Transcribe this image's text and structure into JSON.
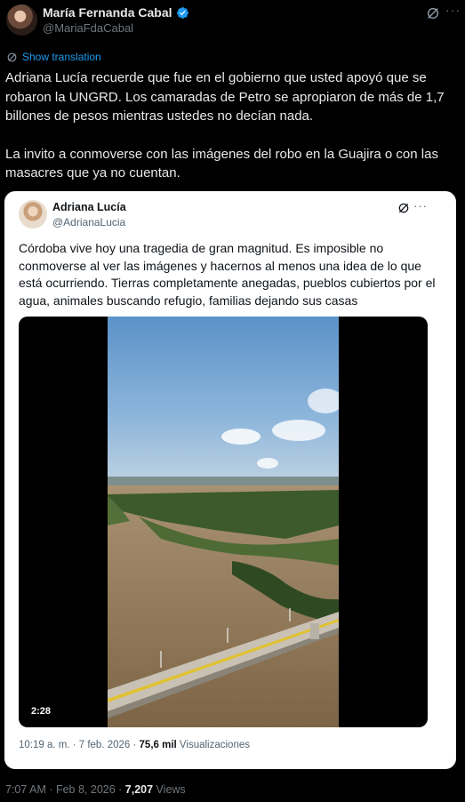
{
  "author": {
    "name": "María Fernanda Cabal",
    "handle": "@MariaFdaCabal"
  },
  "translate_label": "Show translation",
  "tweet": {
    "paragraph1": "Adriana Lucía recuerde que fue en el gobierno que usted apoyó que se robaron la UNGRD. Los camaradas de Petro se apropiaron de más de 1,7 billones de pesos mientras ustedes no decían nada.",
    "paragraph2": "La invito a conmoverse con las imágenes del robo en la Guajira o con las masacres que ya no cuentan."
  },
  "quoted": {
    "name": "Adriana Lucía",
    "handle": "@AdrianaLucia",
    "text": "Córdoba vive hoy una tragedia de gran magnitud. Es imposible no conmoverse al ver las imágenes y hacernos al menos una idea de lo que está ocurriendo. Tierras completamente anegadas, pueblos cubiertos por el agua, animales buscando refugio, familias dejando sus casas",
    "video_duration": "2:28",
    "time": "10:19 a. m. · 7 feb. 2026 · ",
    "views_count": "75,6 mil",
    "views_label": " Visualizaciones"
  },
  "footer": {
    "time": "7:07 AM · Feb 8, 2026 · ",
    "views_count": "7,207",
    "views_label": " Views"
  },
  "colors": {
    "background": "#000000",
    "accent": "#1d9bf0",
    "verified": "#1d9bf0",
    "muted": "#71767b"
  },
  "icons": [
    "verified-badge-icon",
    "grok-icon",
    "more-icon",
    "translate-icon"
  ]
}
